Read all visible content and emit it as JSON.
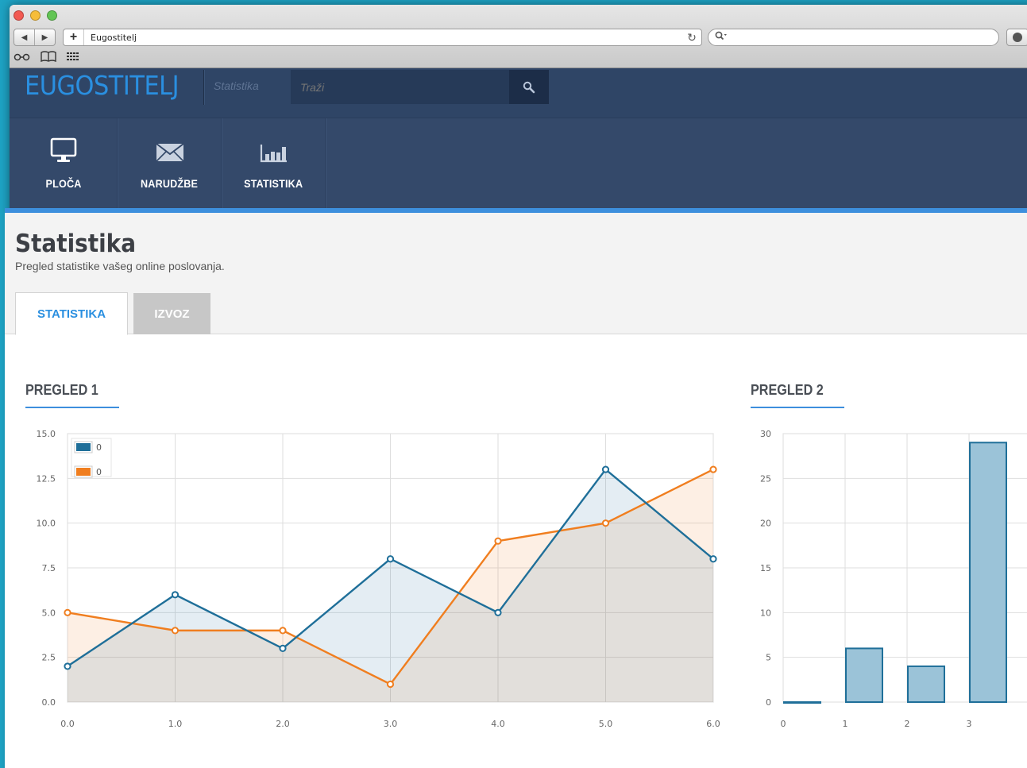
{
  "browser": {
    "url_text": "Eugostitelj"
  },
  "app": {
    "logo": "EUGOSTITELJ",
    "section": "Statistika",
    "search_placeholder": "Traži"
  },
  "nav": {
    "items": [
      {
        "label": "PLOČA",
        "icon": "monitor-icon"
      },
      {
        "label": "NARUDŽBE",
        "icon": "envelope-icon"
      },
      {
        "label": "STATISTIKA",
        "icon": "bar-chart-icon"
      }
    ]
  },
  "page": {
    "title": "Statistika",
    "subtitle": "Pregled statistike vašeg online poslovanja.",
    "tabs": [
      {
        "label": "STATISTIKA",
        "active": true
      },
      {
        "label": "IZVOZ",
        "active": false
      }
    ]
  },
  "panels": {
    "p1_title": "PREGLED 1",
    "p2_title": "PREGLED 2"
  },
  "colors": {
    "accent": "#3d8fdd",
    "series_blue": "#1f6f99",
    "series_orange": "#f07e1f",
    "bar_fill": "#9bc3d8",
    "bar_stroke": "#1f6f99"
  },
  "chart_data": [
    {
      "type": "line",
      "title": "PREGLED 1",
      "x": [
        0,
        1,
        2,
        3,
        4,
        5,
        6
      ],
      "x_tick_labels": [
        "0.0",
        "1.0",
        "2.0",
        "3.0",
        "4.0",
        "5.0",
        "6.0"
      ],
      "y_tick_labels": [
        "0.0",
        "2.5",
        "5.0",
        "7.5",
        "10.0",
        "12.5",
        "15.0"
      ],
      "xlim": [
        0,
        6
      ],
      "ylim": [
        0,
        15
      ],
      "legend": "top-left",
      "legend_labels": [
        "0",
        "0"
      ],
      "grid": true,
      "series": [
        {
          "values": [
            2,
            6,
            3,
            8,
            5,
            13,
            8
          ]
        },
        {
          "values": [
            5,
            4,
            4,
            1,
            9,
            10,
            13
          ]
        }
      ]
    },
    {
      "type": "bar",
      "title": "PREGLED 2",
      "categories": [
        "0",
        "1",
        "2",
        "3"
      ],
      "values": [
        0,
        6,
        4,
        29
      ],
      "y_tick_labels": [
        "0",
        "5",
        "10",
        "15",
        "20",
        "25",
        "30"
      ],
      "ylim": [
        0,
        30
      ],
      "grid": true
    }
  ]
}
